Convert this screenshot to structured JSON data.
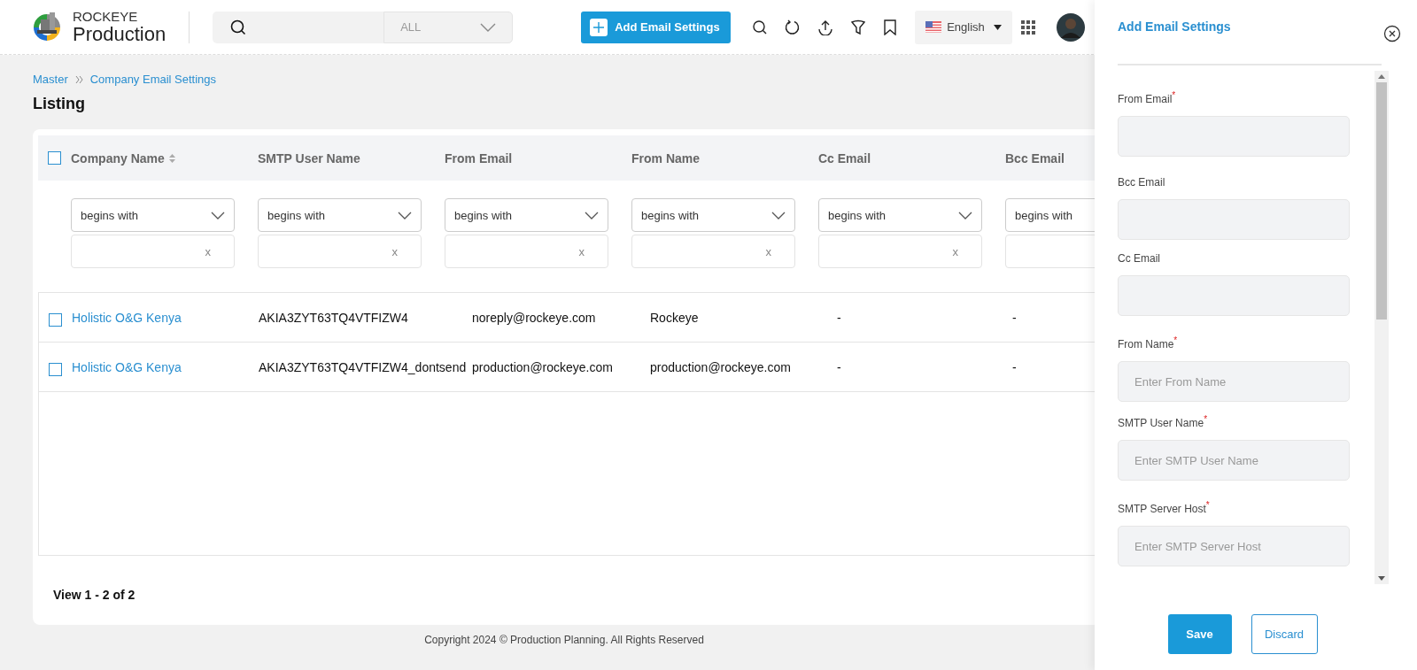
{
  "header": {
    "brand_top": "ROCKEYE",
    "brand_name": "Production",
    "search": {
      "scope": "ALL"
    },
    "add_button": "Add Email Settings",
    "language": "English"
  },
  "breadcrumb": [
    "Master",
    "Company Email Settings"
  ],
  "page_title": "Listing",
  "table": {
    "select_all": {
      "checked": false
    },
    "columns": [
      {
        "label": "Company Name",
        "sortable": true
      },
      {
        "label": "SMTP User Name",
        "sortable": false
      },
      {
        "label": "From Email",
        "sortable": false
      },
      {
        "label": "From Name",
        "sortable": false
      },
      {
        "label": "Cc Email",
        "sortable": false
      },
      {
        "label": "Bcc Email",
        "sortable": false
      }
    ],
    "filters": [
      {
        "operator": "begins with",
        "clear": "x"
      },
      {
        "operator": "begins with",
        "clear": "x"
      },
      {
        "operator": "begins with",
        "clear": "x"
      },
      {
        "operator": "begins with",
        "clear": "x"
      },
      {
        "operator": "begins with",
        "clear": "x"
      },
      {
        "operator": "begins with"
      }
    ],
    "rows": [
      {
        "checked": false,
        "cells": [
          "Holistic O&G Kenya",
          "AKIA3ZYT63TQ4VTFIZW4",
          "noreply@rockeye.com",
          "Rockeye",
          "-",
          "-"
        ]
      },
      {
        "checked": false,
        "cells": [
          "Holistic O&G Kenya",
          "AKIA3ZYT63TQ4VTFIZW4_dontsend",
          "production@rockeye.com",
          "production@rockeye.com",
          "-",
          "-"
        ]
      }
    ],
    "pager": "View 1 - 2 of 2"
  },
  "footer": "Copyright 2024 © Production Planning. All Rights Reserved",
  "panel": {
    "title": "Add Email Settings",
    "fields": [
      {
        "label": "From Email",
        "required_mark": "*"
      },
      {
        "label": "Bcc Email"
      },
      {
        "label": "Cc Email"
      },
      {
        "label": "From Name",
        "required_mark": "*",
        "placeholder": "Enter From Name"
      },
      {
        "label": "SMTP User Name",
        "required_mark": "*",
        "placeholder": "Enter SMTP User Name"
      },
      {
        "label": "SMTP Server Host",
        "required_mark": "*",
        "placeholder": "Enter SMTP Server Host"
      }
    ],
    "buttons": [
      {
        "label": "Save",
        "kind": "primary"
      },
      {
        "label": "Discard",
        "kind": "secondary"
      }
    ]
  }
}
